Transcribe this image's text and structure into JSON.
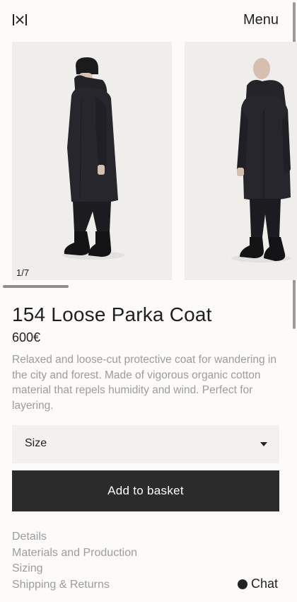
{
  "header": {
    "logo_alt": "|x|",
    "menu_label": "Menu"
  },
  "gallery": {
    "counter": "1/7",
    "current_index": 1,
    "total_images": 7
  },
  "product": {
    "title": "154 Loose Parka Coat",
    "price": "600€",
    "description": "Relaxed and loose-cut protective coat for wandering in the city and forest. Made of vigorous organic cotton material that repels humidity and wind. Perfect for layering."
  },
  "size_select": {
    "label": "Size"
  },
  "actions": {
    "add_to_basket": "Add to basket"
  },
  "info_links": [
    "Details",
    "Materials and Production",
    "Sizing",
    "Shipping & Returns"
  ],
  "chat": {
    "label": "Chat"
  },
  "colors": {
    "background": "#fcfbf9",
    "text": "#222222",
    "muted_text": "#9c9c9c",
    "button": "#2b2b2c",
    "select_bg": "#f2f1ee"
  },
  "icons": {
    "logo": "brand-logo-icon",
    "dropdown": "chevron-down-icon",
    "chat": "chat-dot-icon"
  }
}
